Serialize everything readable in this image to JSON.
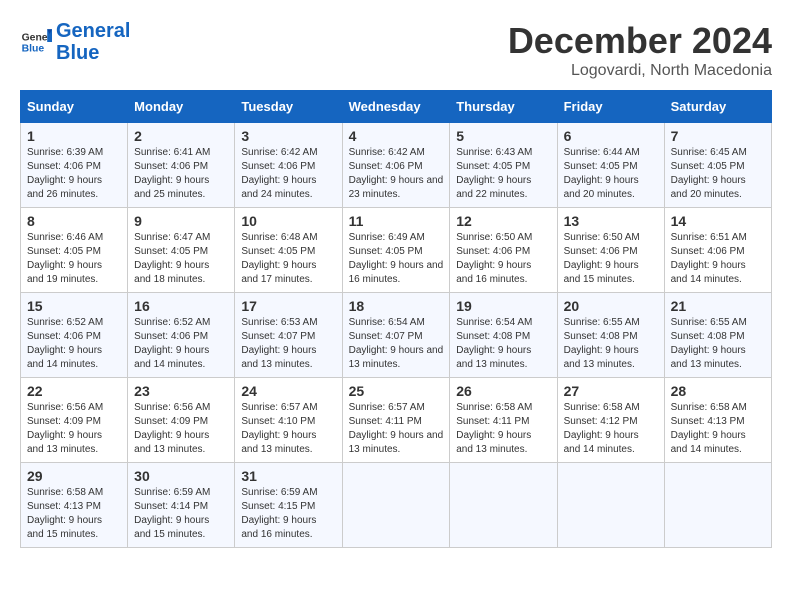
{
  "header": {
    "logo_general": "General",
    "logo_blue": "Blue",
    "title": "December 2024",
    "subtitle": "Logovardi, North Macedonia"
  },
  "weekdays": [
    "Sunday",
    "Monday",
    "Tuesday",
    "Wednesday",
    "Thursday",
    "Friday",
    "Saturday"
  ],
  "weeks": [
    [
      {
        "day": "1",
        "sunrise": "6:39 AM",
        "sunset": "4:06 PM",
        "daylight": "9 hours and 26 minutes."
      },
      {
        "day": "2",
        "sunrise": "6:41 AM",
        "sunset": "4:06 PM",
        "daylight": "9 hours and 25 minutes."
      },
      {
        "day": "3",
        "sunrise": "6:42 AM",
        "sunset": "4:06 PM",
        "daylight": "9 hours and 24 minutes."
      },
      {
        "day": "4",
        "sunrise": "6:42 AM",
        "sunset": "4:06 PM",
        "daylight": "9 hours and 23 minutes."
      },
      {
        "day": "5",
        "sunrise": "6:43 AM",
        "sunset": "4:05 PM",
        "daylight": "9 hours and 22 minutes."
      },
      {
        "day": "6",
        "sunrise": "6:44 AM",
        "sunset": "4:05 PM",
        "daylight": "9 hours and 20 minutes."
      },
      {
        "day": "7",
        "sunrise": "6:45 AM",
        "sunset": "4:05 PM",
        "daylight": "9 hours and 20 minutes."
      }
    ],
    [
      {
        "day": "8",
        "sunrise": "6:46 AM",
        "sunset": "4:05 PM",
        "daylight": "9 hours and 19 minutes."
      },
      {
        "day": "9",
        "sunrise": "6:47 AM",
        "sunset": "4:05 PM",
        "daylight": "9 hours and 18 minutes."
      },
      {
        "day": "10",
        "sunrise": "6:48 AM",
        "sunset": "4:05 PM",
        "daylight": "9 hours and 17 minutes."
      },
      {
        "day": "11",
        "sunrise": "6:49 AM",
        "sunset": "4:05 PM",
        "daylight": "9 hours and 16 minutes."
      },
      {
        "day": "12",
        "sunrise": "6:50 AM",
        "sunset": "4:06 PM",
        "daylight": "9 hours and 16 minutes."
      },
      {
        "day": "13",
        "sunrise": "6:50 AM",
        "sunset": "4:06 PM",
        "daylight": "9 hours and 15 minutes."
      },
      {
        "day": "14",
        "sunrise": "6:51 AM",
        "sunset": "4:06 PM",
        "daylight": "9 hours and 14 minutes."
      }
    ],
    [
      {
        "day": "15",
        "sunrise": "6:52 AM",
        "sunset": "4:06 PM",
        "daylight": "9 hours and 14 minutes."
      },
      {
        "day": "16",
        "sunrise": "6:52 AM",
        "sunset": "4:06 PM",
        "daylight": "9 hours and 14 minutes."
      },
      {
        "day": "17",
        "sunrise": "6:53 AM",
        "sunset": "4:07 PM",
        "daylight": "9 hours and 13 minutes."
      },
      {
        "day": "18",
        "sunrise": "6:54 AM",
        "sunset": "4:07 PM",
        "daylight": "9 hours and 13 minutes."
      },
      {
        "day": "19",
        "sunrise": "6:54 AM",
        "sunset": "4:08 PM",
        "daylight": "9 hours and 13 minutes."
      },
      {
        "day": "20",
        "sunrise": "6:55 AM",
        "sunset": "4:08 PM",
        "daylight": "9 hours and 13 minutes."
      },
      {
        "day": "21",
        "sunrise": "6:55 AM",
        "sunset": "4:08 PM",
        "daylight": "9 hours and 13 minutes."
      }
    ],
    [
      {
        "day": "22",
        "sunrise": "6:56 AM",
        "sunset": "4:09 PM",
        "daylight": "9 hours and 13 minutes."
      },
      {
        "day": "23",
        "sunrise": "6:56 AM",
        "sunset": "4:09 PM",
        "daylight": "9 hours and 13 minutes."
      },
      {
        "day": "24",
        "sunrise": "6:57 AM",
        "sunset": "4:10 PM",
        "daylight": "9 hours and 13 minutes."
      },
      {
        "day": "25",
        "sunrise": "6:57 AM",
        "sunset": "4:11 PM",
        "daylight": "9 hours and 13 minutes."
      },
      {
        "day": "26",
        "sunrise": "6:58 AM",
        "sunset": "4:11 PM",
        "daylight": "9 hours and 13 minutes."
      },
      {
        "day": "27",
        "sunrise": "6:58 AM",
        "sunset": "4:12 PM",
        "daylight": "9 hours and 14 minutes."
      },
      {
        "day": "28",
        "sunrise": "6:58 AM",
        "sunset": "4:13 PM",
        "daylight": "9 hours and 14 minutes."
      }
    ],
    [
      {
        "day": "29",
        "sunrise": "6:58 AM",
        "sunset": "4:13 PM",
        "daylight": "9 hours and 15 minutes."
      },
      {
        "day": "30",
        "sunrise": "6:59 AM",
        "sunset": "4:14 PM",
        "daylight": "9 hours and 15 minutes."
      },
      {
        "day": "31",
        "sunrise": "6:59 AM",
        "sunset": "4:15 PM",
        "daylight": "9 hours and 16 minutes."
      },
      null,
      null,
      null,
      null
    ]
  ],
  "labels": {
    "sunrise": "Sunrise:",
    "sunset": "Sunset:",
    "daylight": "Daylight:"
  }
}
